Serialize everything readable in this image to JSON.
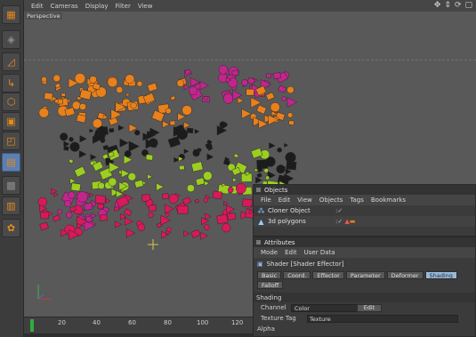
{
  "viewport": {
    "menu": [
      "Edit",
      "Cameras",
      "Display",
      "Filter",
      "View"
    ],
    "camera_label": "Perspective",
    "nav_icons": [
      "move-icon",
      "zoom-icon",
      "rotate-icon",
      "maximize-icon"
    ]
  },
  "palette": {
    "tools": [
      "view-layout-icon",
      "cube-icon",
      "perspective-icon",
      "axis-icon",
      "polygon-icon",
      "points-icon",
      "edges-icon",
      "polygons-icon",
      "texture-icon",
      "checker-icon",
      "snap-icon",
      "mograph-icon"
    ]
  },
  "timeline": {
    "ticks": [
      "20",
      "40",
      "60",
      "80",
      "100",
      "120",
      "140",
      "160",
      "180",
      "200"
    ],
    "current_frame": 0
  },
  "objects_panel": {
    "title": "Objects",
    "menu": [
      "File",
      "Edit",
      "View",
      "Objects",
      "Tags",
      "Bookmarks"
    ],
    "rows": [
      {
        "name": "Cloner Object",
        "icon": "cloner-icon"
      },
      {
        "name": "3d polygons",
        "icon": "polygon-object-icon"
      }
    ]
  },
  "attributes_panel": {
    "title": "Attributes",
    "menu": [
      "Mode",
      "Edit",
      "User Data"
    ],
    "object_name": "Shader [Shader Effector]",
    "tabs": [
      "Basic",
      "Coord.",
      "Effector",
      "Parameter",
      "Deformer",
      "Shading",
      "Falloff"
    ],
    "active_tab": "Shading",
    "section": "Shading",
    "channel_label": "Channel",
    "channel_value": "Color",
    "edit_button": "Edit",
    "texture_tag_label": "Texture Tag",
    "texture_tag_value": "Texture",
    "alpha_label": "Alpha"
  },
  "colors": {
    "orange": "#e8801c",
    "magenta": "#c0268c",
    "lime": "#9ccd22",
    "black": "#1c1c1c",
    "crimson": "#d8195a",
    "selection_blue": "#9ab8d8"
  }
}
